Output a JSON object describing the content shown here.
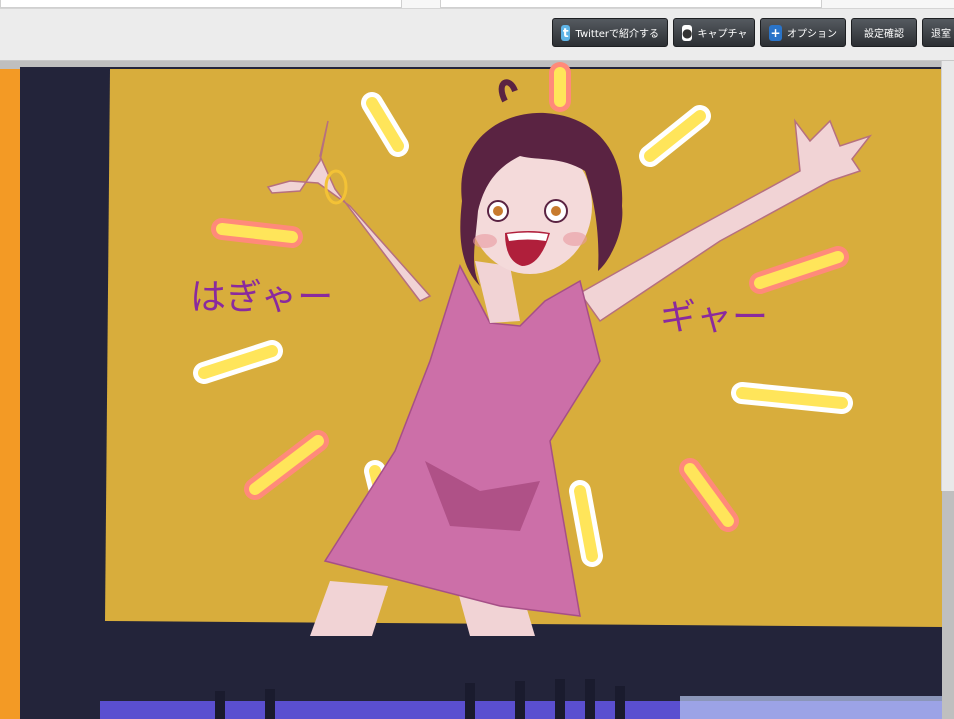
{
  "toolbar": {
    "twitter_label": "Twitterで紹介する",
    "capture_label": "キャプチャ",
    "options_label": "オプション",
    "settings_label": "設定確認",
    "exit_label": "退室"
  },
  "icons": {
    "twitter": "twitter-bird-icon",
    "capture": "person-capture-icon",
    "options": "plus-icon"
  },
  "drawing": {
    "text_left": "はぎゃー",
    "text_right": "ギャー"
  },
  "colors": {
    "canvas_bg": "#d8ad3c",
    "frame": "#23243a",
    "dress": "#cc6fa8",
    "hair": "#5a2342",
    "skin": "#f1d3d5",
    "orange_edge": "#f39a25"
  }
}
